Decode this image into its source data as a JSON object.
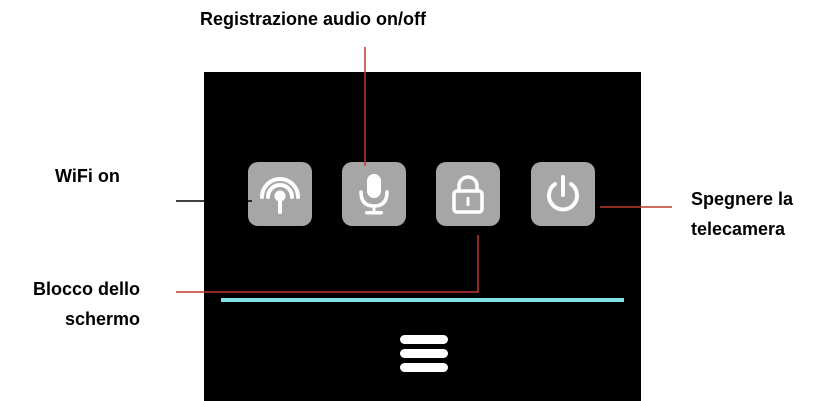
{
  "labels": {
    "mic": "Registrazione audio on/off",
    "wifi": "WiFi on",
    "power_line1": "Spegnere la",
    "power_line2": "telecamera",
    "lock_line1": "Blocco dello",
    "lock_line2": "schermo"
  },
  "screen": {
    "icons": [
      "wifi-icon",
      "microphone-icon",
      "lock-icon",
      "power-icon"
    ],
    "progress": 1.0,
    "colors": {
      "screen_bg": "#000000",
      "tile_bg": "#a6a6a6",
      "icon": "#ffffff",
      "progress": "#7fe0e6",
      "wifi_leader": "#000000",
      "red_leaders": "#c0392b"
    }
  }
}
